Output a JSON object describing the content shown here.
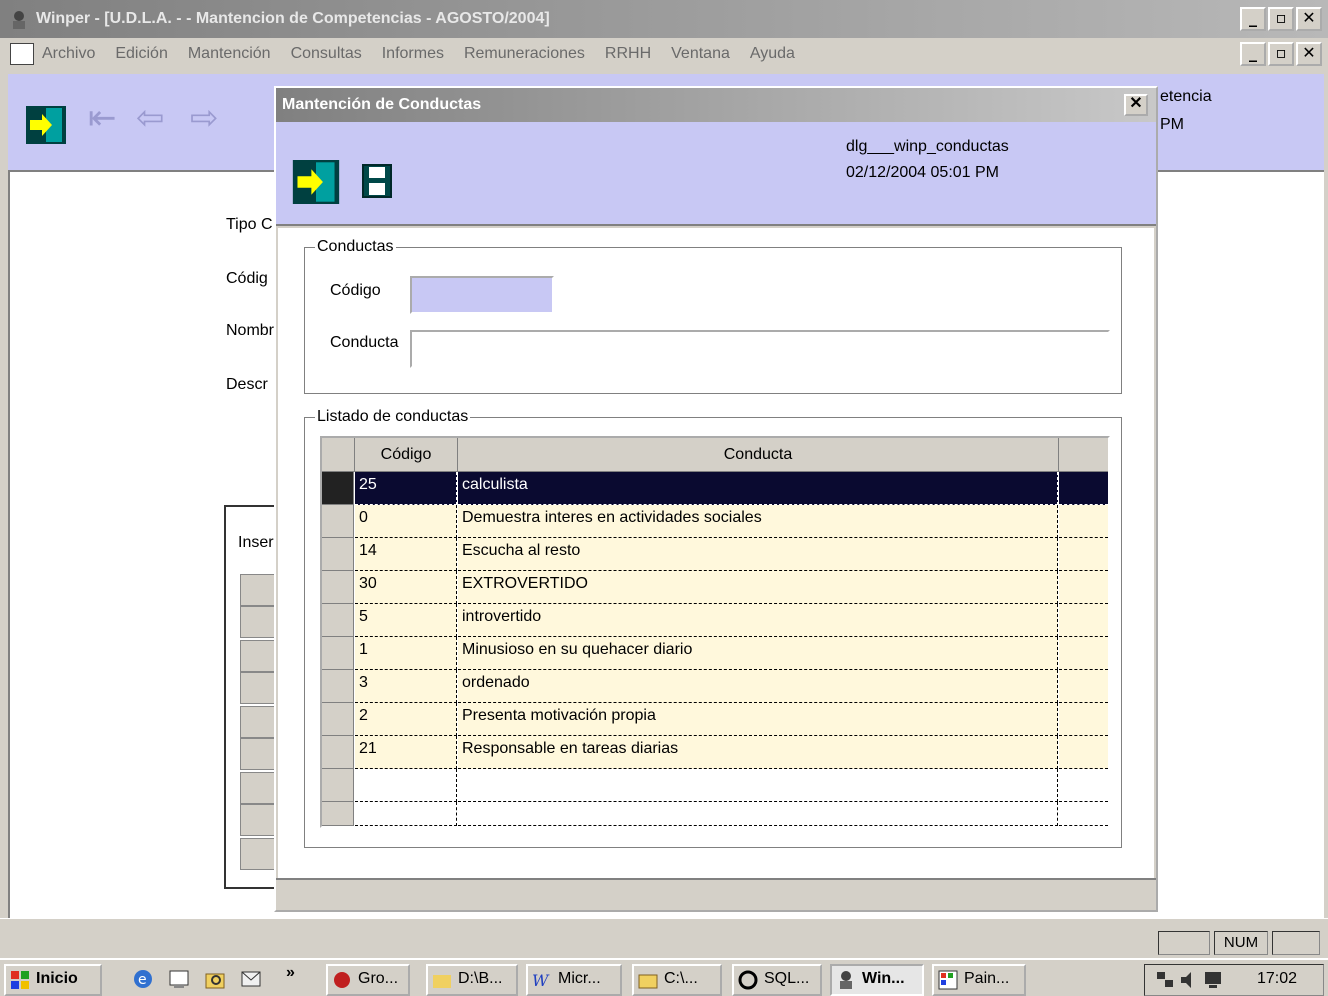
{
  "window": {
    "title": "Winper - [U.D.L.A. -  - Mantencion de Competencias - AGOSTO/2004]"
  },
  "menu": [
    "Archivo",
    "Edición",
    "Mantención",
    "Consultas",
    "Informes",
    "Remuneraciones",
    "RRHH",
    "Ventana",
    "Ayuda"
  ],
  "background": {
    "labels": {
      "tipo": "Tipo C",
      "codigo": "Códig",
      "nombre": "Nombr",
      "descr": "Descr",
      "insert": "Inser"
    },
    "right_text": {
      "line1": "etencia",
      "line2": "PM"
    }
  },
  "dialog": {
    "title": "Mantención de Conductas",
    "object_name": "dlg___winp_conductas",
    "timestamp": "02/12/2004 05:01 PM",
    "group1": "Conductas",
    "codigo_label": "Código",
    "conducta_label": "Conducta",
    "codigo_value": "",
    "conducta_value": "",
    "group2": "Listado de conductas",
    "table": {
      "headers": [
        "Código",
        "Conducta"
      ],
      "rows": [
        {
          "codigo": "25",
          "conducta": "calculista"
        },
        {
          "codigo": "0",
          "conducta": "Demuestra interes en actividades sociales"
        },
        {
          "codigo": "14",
          "conducta": "Escucha al resto"
        },
        {
          "codigo": "30",
          "conducta": "EXTROVERTIDO"
        },
        {
          "codigo": "5",
          "conducta": "introvertido"
        },
        {
          "codigo": "1",
          "conducta": "Minusioso en su quehacer diario"
        },
        {
          "codigo": "3",
          "conducta": "ordenado"
        },
        {
          "codigo": "2",
          "conducta": "Presenta motivación propia"
        },
        {
          "codigo": "21",
          "conducta": "Responsable en tareas diarias"
        }
      ]
    }
  },
  "status": {
    "num": "NUM"
  },
  "taskbar": {
    "start": "Inicio",
    "chevron": "»",
    "buttons": [
      "Gro...",
      "D:\\B...",
      "Micr...",
      "C:\\...",
      "SQL...",
      "Win...",
      "Pain..."
    ],
    "clock": "17:02"
  },
  "colors": {
    "header_bg": "#c8c8f4",
    "row_bg": "#fff8dc",
    "selected_row": "#0a0a30"
  }
}
